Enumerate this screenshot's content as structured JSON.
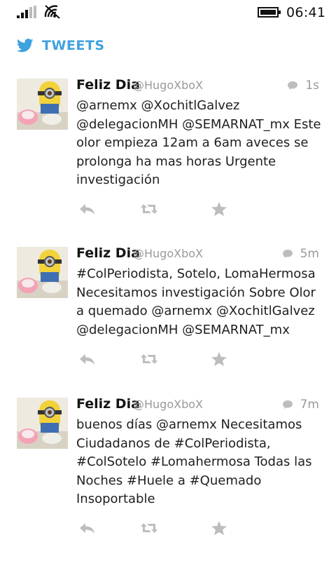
{
  "status_bar": {
    "time": "06:41"
  },
  "header": {
    "title": "TWEETS"
  },
  "tweets": [
    {
      "name": "Feliz Dia",
      "handle": "@HugoXboX",
      "age": "1s",
      "text": "@arnemx @XochitlGalvez @delegacionMH @SEMARNAT_mx Este olor empieza 12am a 6am aveces se prolonga ha mas horas Urgente investigación"
    },
    {
      "name": "Feliz Dia",
      "handle": "@HugoXboX",
      "age": "5m",
      "text": "#ColPeriodista, Sotelo, LomaHermosa Necesitamos investigación Sobre Olor a quemado @arnemx @XochitlGalvez @delegacionMH @SEMARNAT_mx"
    },
    {
      "name": "Feliz Dia",
      "handle": "@HugoXboX",
      "age": "7m",
      "text": "buenos días @arnemx Necesitamos Ciudadanos de #ColPeriodista, #ColSotelo #Lomahermosa Todas las Noches #Huele a #Quemado Insoportable"
    }
  ],
  "colors": {
    "accent": "#3fa2df",
    "icon_gray": "#bdbdbd",
    "meta_gray": "#9a9a9a"
  },
  "icons": {
    "reply": "reply-icon",
    "retweet": "retweet-icon",
    "favorite": "star-icon",
    "conversation": "speech-bubble-icon",
    "brand": "twitter-bird-icon"
  }
}
